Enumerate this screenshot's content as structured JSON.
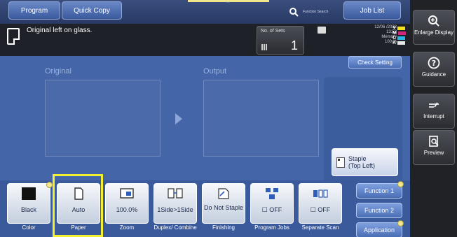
{
  "topbar": {
    "program_label": "Program",
    "quick_copy_label": "Quick Copy",
    "scroll_hint": "«»",
    "function_search_label": "Function Search",
    "job_list_label": "Job List"
  },
  "status": {
    "message": "Original left on glass.",
    "sets_label": "No. of Sets",
    "sets_value": "1",
    "date": "12/06 /2022",
    "time": "13:52",
    "memory_label": "Memory",
    "memory_value": "100 %",
    "toner": [
      {
        "letter": "Y",
        "color": "#f2e21a"
      },
      {
        "letter": "M",
        "color": "#d0267e"
      },
      {
        "letter": "C",
        "color": "#2ab3e8"
      },
      {
        "letter": "K",
        "color": "#e8e8e8"
      }
    ]
  },
  "side": {
    "enlarge_label": "Enlarge Display",
    "guidance_label": "Guidance",
    "interrupt_label": "Interrupt",
    "preview_label": "Preview"
  },
  "main": {
    "check_setting_label": "Check Setting",
    "original_label": "Original",
    "output_label": "Output",
    "staple_label_line1": "Staple",
    "staple_label_line2": "(Top Left)"
  },
  "functions": [
    {
      "value": "Black",
      "label": "Color"
    },
    {
      "value": "Auto",
      "label": "Paper"
    },
    {
      "value": "100.0%",
      "label": "Zoom"
    },
    {
      "value": "1Side>1Side",
      "label": "Duplex/ Combine"
    },
    {
      "value": "Do Not Staple",
      "label": "Finishing"
    },
    {
      "value": "OFF",
      "label": "Program Jobs"
    },
    {
      "value": "OFF",
      "label": "Separate Scan"
    }
  ],
  "function_tabs": {
    "function1_label": "Function 1",
    "function2_label": "Function 2",
    "application_label": "Application"
  },
  "colors": {
    "accent_blue": "#4466a8",
    "highlight_yellow": "#f2f030"
  }
}
